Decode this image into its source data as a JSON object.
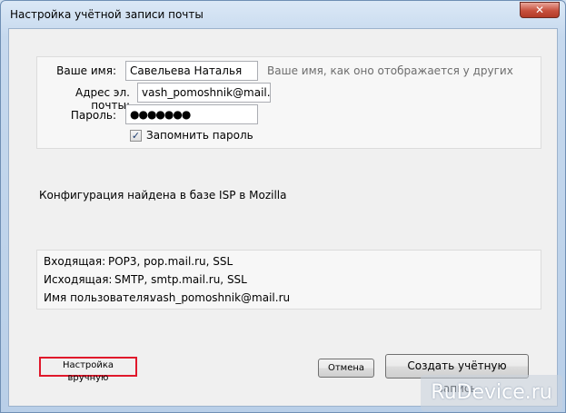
{
  "window": {
    "title": "Настройка учётной записи почты",
    "close_glyph": "✕"
  },
  "form": {
    "name_label": "Ваше имя:",
    "name_value": "Савельева Наталья",
    "name_hint": "Ваше имя, как оно отображается у других",
    "email_label": "Адрес эл. почты:",
    "email_value": "vash_pomoshnik@mail.ru",
    "password_label": "Пароль:",
    "password_value": "●●●●●●●",
    "remember_label": "Запомнить пароль",
    "remember_checked": true
  },
  "status": {
    "message": "Конфигурация найдена в базе ISP в Mozilla"
  },
  "config": {
    "incoming_label": "Входящая:",
    "incoming_value": "POP3, pop.mail.ru, SSL",
    "outgoing_label": "Исходящая:",
    "outgoing_value": "SMTP, smtp.mail.ru, SSL",
    "username_label": "Имя пользователя:",
    "username_value": "vash_pomoshnik@mail.ru"
  },
  "buttons": {
    "manual": "Настройка вручную",
    "cancel": "Отмена",
    "create": "Создать учётную запись"
  },
  "watermark": {
    "text": "RuDevice.ru"
  },
  "colors": {
    "highlight": "#e0182b",
    "close_button": "#c7503d"
  },
  "icons": {
    "checkbox": "check-mark"
  }
}
